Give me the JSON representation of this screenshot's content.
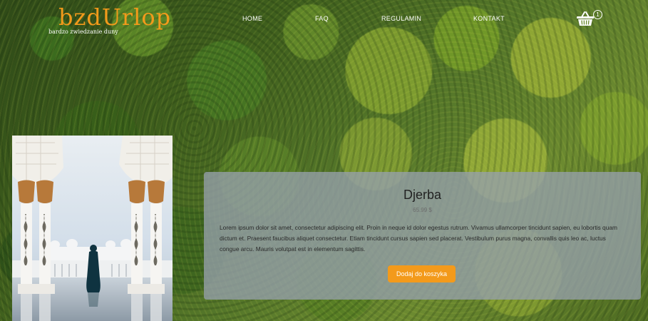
{
  "brand": {
    "logo": "bzdUrlop",
    "tagline": "bardzo zwiedzanie duny"
  },
  "nav": {
    "items": [
      "HOME",
      "FAQ",
      "REGULAMIN",
      "KONTAKT"
    ]
  },
  "cart": {
    "icon": "basket-icon",
    "count": "1"
  },
  "product": {
    "image": "mosque-arches-photo",
    "title": "Djerba",
    "price": "65.99 $",
    "description": "Lorem ipsum dolor sit amet, consectetur adipiscing elit. Proin in neque id dolor egestus rutrum. Vivamus ullamcorper tincidunt sapien, eu lobortis quam dictum et. Praesent faucibus aliquet consectetur. Etiam tincidunt cursus sapien sed placerat. Vestibulum purus magna, convallis quis leo ac, luctus congue arcu. Mauris volutpat est in elementum sagittis.",
    "button_label": "Dodaj do koszyka"
  },
  "colors": {
    "accent": "#f39a1b",
    "card_bg": "#96a0ac"
  }
}
